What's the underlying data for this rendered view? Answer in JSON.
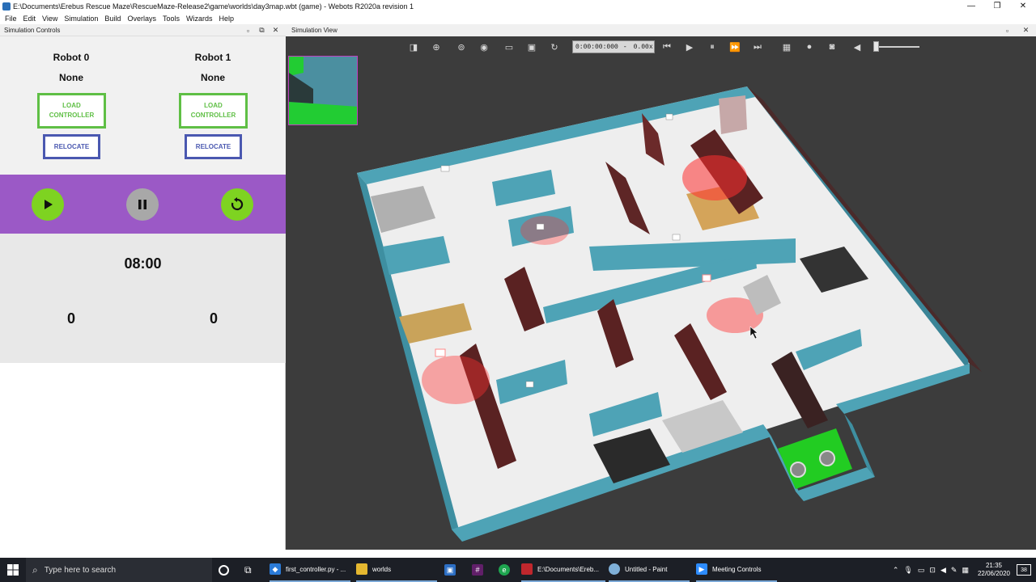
{
  "window": {
    "title": "E:\\Documents\\Erebus Rescue Maze\\RescueMaze-Release2\\game\\worlds\\day3map.wbt (game) - Webots R2020a revision 1",
    "minimize": "—",
    "maximize": "❐",
    "close": "✕"
  },
  "menu": [
    "File",
    "Edit",
    "View",
    "Simulation",
    "Build",
    "Overlays",
    "Tools",
    "Wizards",
    "Help"
  ],
  "sim_controls": {
    "panel_title": "Simulation Controls",
    "robots": [
      {
        "name": "Robot 0",
        "controller": "None",
        "load_label": "LOAD CONTROLLER",
        "relocate_label": "RELOCATE",
        "score": "0"
      },
      {
        "name": "Robot 1",
        "controller": "None",
        "load_label": "LOAD CONTROLLER",
        "relocate_label": "RELOCATE",
        "score": "0"
      }
    ],
    "timer": "08:00",
    "colors": {
      "load": "#5fbf45",
      "relocate": "#4a58b0",
      "controls_bg": "#9b59c6"
    }
  },
  "sim_view": {
    "panel_title": "Simulation View",
    "time": "0:00:00:000",
    "separator": "-",
    "speed": "0.00x",
    "toolbar_icons": [
      "toggle-tree-icon",
      "add-node-icon",
      "viewpoint-icon",
      "eye-icon",
      "open-folder-icon",
      "save-icon",
      "reload-icon",
      "step-back-icon",
      "play-icon",
      "pause-icon",
      "fast-icon",
      "fastest-icon",
      "render-icon",
      "record-icon",
      "screenshot-icon",
      "volume-icon"
    ]
  },
  "taskbar": {
    "search_placeholder": "Type here to search",
    "apps": [
      {
        "label": "first_controller.py - ...",
        "icon": "vscode-icon",
        "color": "#2b7bd8"
      },
      {
        "label": "worlds",
        "icon": "folder-icon",
        "color": "#e5b830"
      },
      {
        "label": "E:\\Documents\\Ereb...",
        "icon": "webots-icon",
        "color": "#c0272d"
      },
      {
        "label": "Untitled - Paint",
        "icon": "paint-icon",
        "color": "#7fb0d8"
      },
      {
        "label": "Meeting Controls",
        "icon": "zoom-icon",
        "color": "#2d8cff"
      }
    ],
    "time": "21:35",
    "date": "22/06/2020",
    "notifications": "38"
  }
}
